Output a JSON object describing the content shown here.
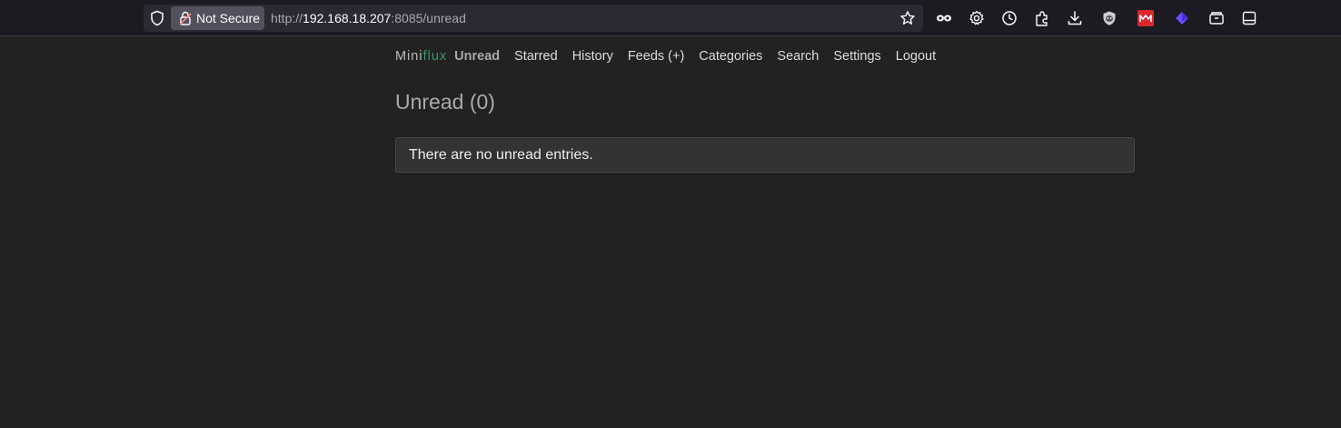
{
  "browser": {
    "security_label": "Not Secure",
    "url_prefix": "http://",
    "url_host": "192.168.18.207",
    "url_rest": ":8085/unread",
    "colors": {
      "toolbar": "#1c1b22",
      "urlbar": "#2b2a33",
      "badge": "#52525e"
    },
    "toolbar_icons": [
      "reader-mode-icon",
      "settings-icon",
      "history-icon",
      "extensions-icon",
      "downloads-icon",
      "privacy-badger-icon",
      "mega-icon",
      "proton-vpn-icon",
      "tab-container-icon",
      "sidebar-icon"
    ]
  },
  "app": {
    "logo_part1": "Mini",
    "logo_part2": "flux",
    "nav": {
      "unread": "Unread",
      "starred": "Starred",
      "history": "History",
      "feeds": "Feeds (+)",
      "categories": "Categories",
      "search": "Search",
      "settings": "Settings",
      "logout": "Logout"
    },
    "title": "Unread (0)",
    "empty_message": "There are no unread entries.",
    "colors": {
      "background": "#222222",
      "accent": "#339966",
      "alert_bg": "#333333"
    }
  }
}
